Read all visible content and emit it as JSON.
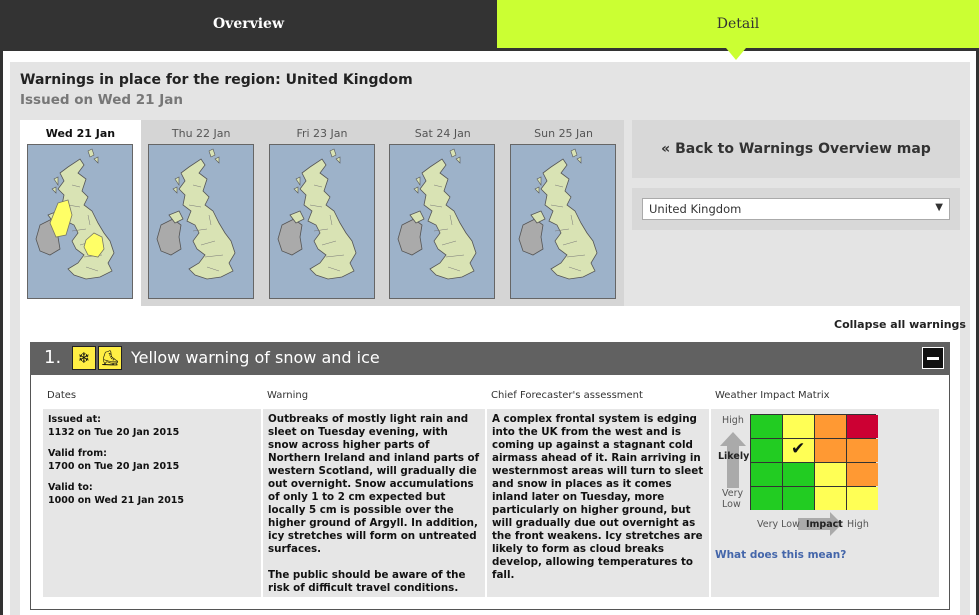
{
  "tabs": {
    "overview": "Overview",
    "detail": "Detail"
  },
  "heading": "Warnings in place for the region: United Kingdom",
  "issued": "Issued on Wed 21 Jan",
  "days": [
    {
      "label": "Wed 21 Jan",
      "active": true
    },
    {
      "label": "Thu 22 Jan",
      "active": false
    },
    {
      "label": "Fri 23 Jan",
      "active": false
    },
    {
      "label": "Sat 24 Jan",
      "active": false
    },
    {
      "label": "Sun 25 Jan",
      "active": false
    }
  ],
  "back_link": "« Back to Warnings Overview map",
  "region_select": {
    "value": "United Kingdom"
  },
  "collapse_all": "Collapse all warnings",
  "warning": {
    "number": "1.",
    "icons": [
      "snowflake-icon",
      "ice-icon"
    ],
    "title": "Yellow warning of snow and ice",
    "columns": {
      "dates": "Dates",
      "warning": "Warning",
      "assessment": "Chief Forecaster's assessment",
      "matrix": "Weather Impact Matrix"
    },
    "issued_at_label": "Issued at:",
    "issued_at": "1132 on Tue 20 Jan 2015",
    "valid_from_label": "Valid from:",
    "valid_from": "1700 on Tue 20 Jan 2015",
    "valid_to_label": "Valid to:",
    "valid_to": "1000 on Wed 21 Jan 2015",
    "text1": "Outbreaks of mostly light rain and sleet on Tuesday evening, with snow across higher parts of Northern Ireland and inland parts of western Scotland, will gradually die out overnight. Snow accumulations of only 1 to 2 cm expected but locally 5 cm is possible over the higher ground of Argyll. In addition, icy stretches will form on untreated surfaces.",
    "text2": "The public should be aware of the risk of difficult travel conditions.",
    "assessment": "A complex frontal system is edging into the UK from the west and is coming up against a stagnant cold airmass ahead of it. Rain arriving in westernmost areas will  turn to sleet and snow in places as it comes inland later on Tuesday, more particularly on higher ground, but will gradually due out overnight as the front weakens. Icy stretches are likely to form as cloud breaks develop, allowing temperatures to fall.",
    "matrix": {
      "likelihood_high": "High",
      "likelihood_mid": "Likely",
      "likelihood_low": "Very Low",
      "impact_low": "Very Low",
      "impact_label": "Impact",
      "impact_high": "High",
      "selected": {
        "likelihood": "Likely",
        "impact": "Low"
      },
      "link": "What does this mean?"
    }
  },
  "colors": {
    "detail_tab": "#cbff33",
    "warning_yellow": "#ffee44",
    "matrix_green": "#22cc22",
    "matrix_yellow": "#ffff55",
    "matrix_orange": "#ff9933",
    "matrix_red": "#cc0033"
  }
}
